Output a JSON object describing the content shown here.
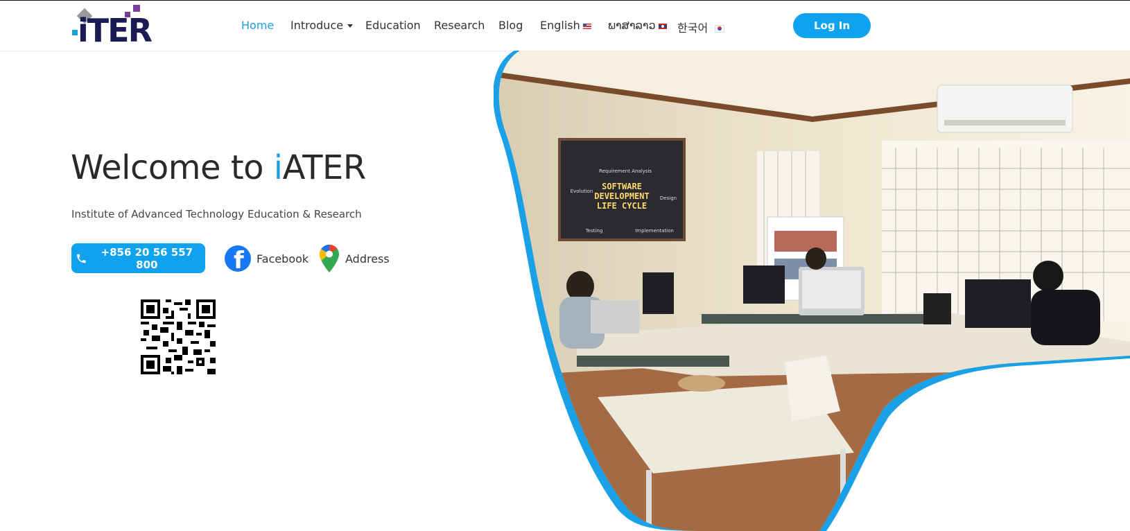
{
  "site": {
    "logo_text": "iTER",
    "brand_color": "#0fa2ef",
    "logo_color": "#1b1a55"
  },
  "nav": {
    "items": [
      {
        "label": "Home",
        "active": true
      },
      {
        "label": "Introduce",
        "dropdown": true
      },
      {
        "label": "Education"
      },
      {
        "label": "Research"
      },
      {
        "label": "Blog"
      },
      {
        "label": "English",
        "flag": "us-flag"
      },
      {
        "label": "ພາສາລາວ",
        "flag": "laos-flag"
      },
      {
        "label": "한국어",
        "flag": "korea-flag"
      }
    ],
    "login_label": "Log In"
  },
  "hero": {
    "title_prefix": "Welcome to ",
    "title_accent": "i",
    "title_suffix": "ATER",
    "subtitle": "Institute of Advanced Technology Education & Research",
    "phone": "+856 20 56 557 800",
    "facebook_label": "Facebook",
    "address_label": "Address"
  },
  "photo": {
    "board_line1": "SOFTWARE",
    "board_line2": "DEVELOPMENT",
    "board_line3": "LIFE CYCLE",
    "board_labels": [
      "Requirement Analysis",
      "Design",
      "Implementation",
      "Testing",
      "Evolution"
    ]
  }
}
